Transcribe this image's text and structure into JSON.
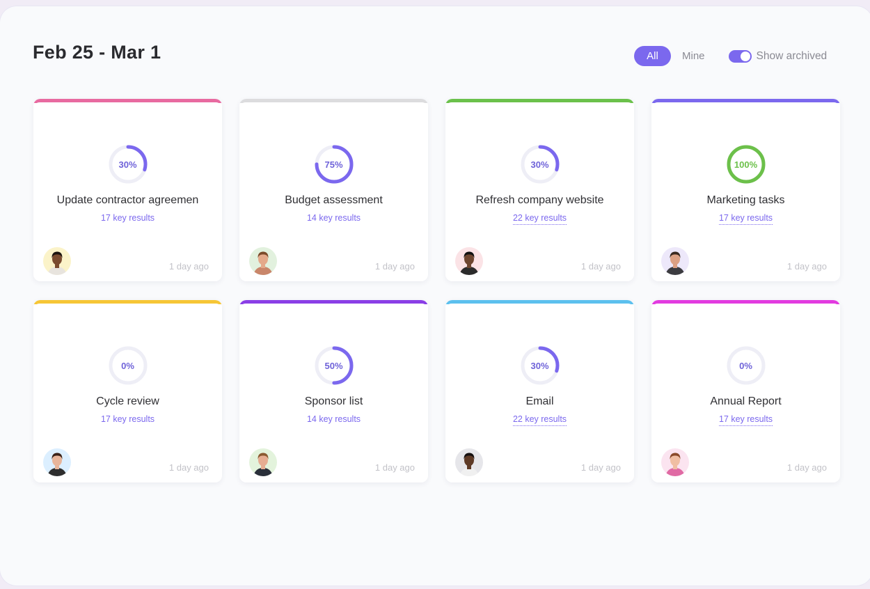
{
  "header": {
    "title": "Feb 25 - Mar 1",
    "filters": [
      {
        "label": "All",
        "active": true
      },
      {
        "label": "Mine",
        "active": false
      }
    ],
    "show_archived": {
      "label": "Show archived",
      "on": true
    }
  },
  "colors": {
    "accent": "#7b68ee",
    "ring_track": "#eeeef6",
    "complete": "#6cc04a"
  },
  "goals": [
    {
      "title": "Update contractor agreemen",
      "progress_pct": 30,
      "progress_label": "30%",
      "key_results": "17 key results",
      "key_results_dotted": false,
      "updated": "1 day ago",
      "stripe_color": "#e86aa0",
      "avatar": {
        "bg": "#fbf3c9",
        "skin": "#7a4b2f",
        "hair": "#1c1410",
        "shirt": "#e8e4de"
      }
    },
    {
      "title": "Budget assessment",
      "progress_pct": 75,
      "progress_label": "75%",
      "key_results": "14 key results",
      "key_results_dotted": false,
      "updated": "1 day ago",
      "stripe_color": "#dcdcde",
      "avatar": {
        "bg": "#e2f1de",
        "skin": "#e4a98a",
        "hair": "#7b4a2a",
        "shirt": "#c9866a"
      }
    },
    {
      "title": "Refresh company website",
      "progress_pct": 30,
      "progress_label": "30%",
      "key_results": "22 key results",
      "key_results_dotted": true,
      "updated": "1 day ago",
      "stripe_color": "#6bc14b",
      "avatar": {
        "bg": "#fbe3e6",
        "skin": "#6e4630",
        "hair": "#111111",
        "shirt": "#2b2b2b"
      }
    },
    {
      "title": "Marketing tasks",
      "progress_pct": 100,
      "progress_label": "100%",
      "key_results": "17 key results",
      "key_results_dotted": true,
      "updated": "1 day ago",
      "stripe_color": "#7b68ee",
      "avatar": {
        "bg": "#ede8fa",
        "skin": "#dca184",
        "hair": "#3a2a20",
        "shirt": "#3c3c40"
      }
    },
    {
      "title": "Cycle review",
      "progress_pct": 0,
      "progress_label": "0%",
      "key_results": "17 key results",
      "key_results_dotted": false,
      "updated": "1 day ago",
      "stripe_color": "#f6c636",
      "avatar": {
        "bg": "#dcefff",
        "skin": "#e8b59a",
        "hair": "#3a2218",
        "shirt": "#2e2e2e"
      }
    },
    {
      "title": "Sponsor list",
      "progress_pct": 50,
      "progress_label": "50%",
      "key_results": "14 key results",
      "key_results_dotted": false,
      "updated": "1 day ago",
      "stripe_color": "#8a3ee6",
      "avatar": {
        "bg": "#e3f3dc",
        "skin": "#e6ad92",
        "hair": "#8a5a30",
        "shirt": "#2a2f3a"
      }
    },
    {
      "title": "Email",
      "progress_pct": 30,
      "progress_label": "30%",
      "key_results": "22 key results",
      "key_results_dotted": true,
      "updated": "1 day ago",
      "stripe_color": "#5cc0ee",
      "avatar": {
        "bg": "#e6e6ea",
        "skin": "#5e3a26",
        "hair": "#151010",
        "shirt": "#f0f0f0"
      }
    },
    {
      "title": "Annual Report",
      "progress_pct": 0,
      "progress_label": "0%",
      "key_results": "17 key results",
      "key_results_dotted": true,
      "updated": "1 day ago",
      "stripe_color": "#e23be0",
      "avatar": {
        "bg": "#fbe4f0",
        "skin": "#f0bea3",
        "hair": "#8a4a2a",
        "shirt": "#e06aa4"
      }
    }
  ]
}
